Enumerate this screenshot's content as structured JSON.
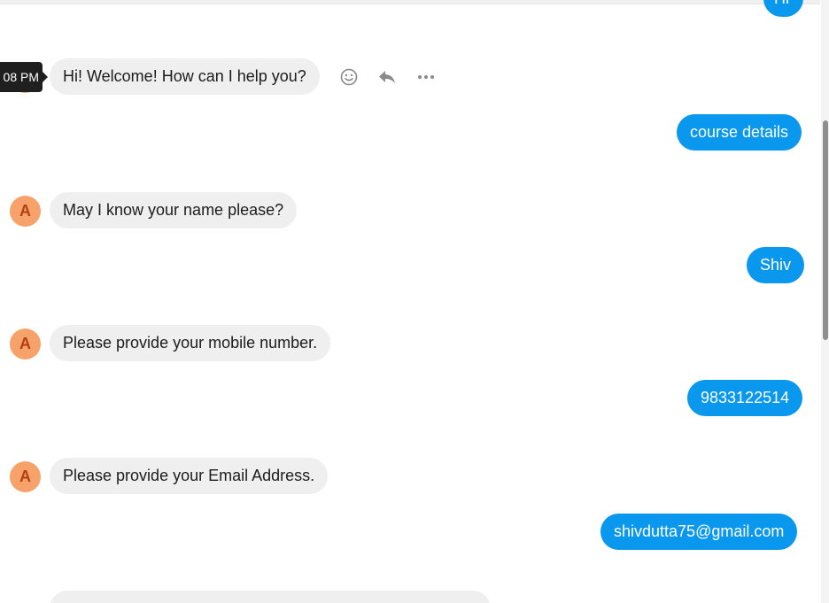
{
  "tooltip": {
    "timestamp": "08 PM"
  },
  "avatar": {
    "initial": "A"
  },
  "messages": {
    "hi": "Hi",
    "welcome": "Hi! Welcome! How can I help you?",
    "course_details": "course details",
    "ask_name": "May I know your name please?",
    "name_reply": "Shiv",
    "ask_mobile": "Please provide your mobile number.",
    "mobile_reply": "9833122514",
    "ask_email": "Please provide your Email Address.",
    "email_reply": "shivdutta75@gmail.com"
  },
  "message_actions": [
    "emoji-icon",
    "reply-icon",
    "more-options-icon"
  ],
  "colors": {
    "outgoing_bubble": "#0a97ee",
    "incoming_bubble": "#f0eff0",
    "avatar_bg": "#f7a26a",
    "avatar_text": "#b33f12"
  }
}
